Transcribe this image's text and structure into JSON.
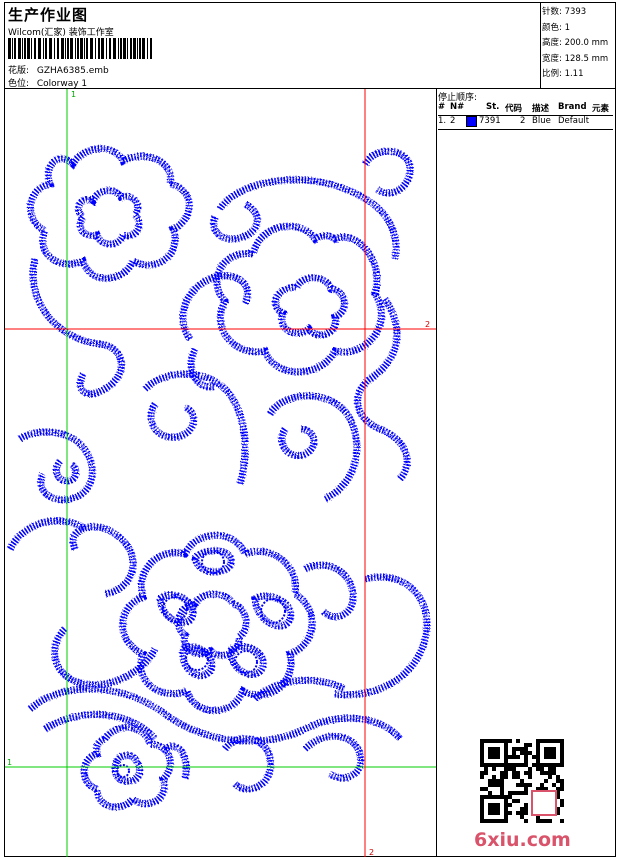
{
  "header": {
    "title": "生产作业图",
    "company": "Wilcom(汇家) 装饰工作室",
    "design_label": "花版:",
    "design_value": "GZHA6385.emb",
    "color_label": "色位:",
    "color_value": "Colorway 1"
  },
  "stats": {
    "stitches": "针数: 7393",
    "colors": "颜色: 1",
    "height": "高度: 200.0 mm",
    "width": "宽度: 128.5 mm",
    "scale": "比例: 1.11"
  },
  "stop_sequence": {
    "title": "停止顺序:",
    "headers": [
      "#",
      "N#",
      "St.",
      "代码",
      "描述",
      "Brand",
      "元素"
    ],
    "rows": [
      {
        "index": "1.",
        "needle": "2",
        "stitches": "7391",
        "code": "2",
        "description": "Blue",
        "brand": "Default",
        "swatch": "#0000ff"
      }
    ]
  },
  "guides": {
    "v1_label": "1",
    "h1_label": "1",
    "h2_label": "2",
    "v2_label": "2",
    "green": "#00cc00",
    "red": "#ff0000"
  },
  "watermark": "6xiu.com",
  "colors": {
    "stitch": "#0000ff",
    "accent": "#d9536a"
  }
}
